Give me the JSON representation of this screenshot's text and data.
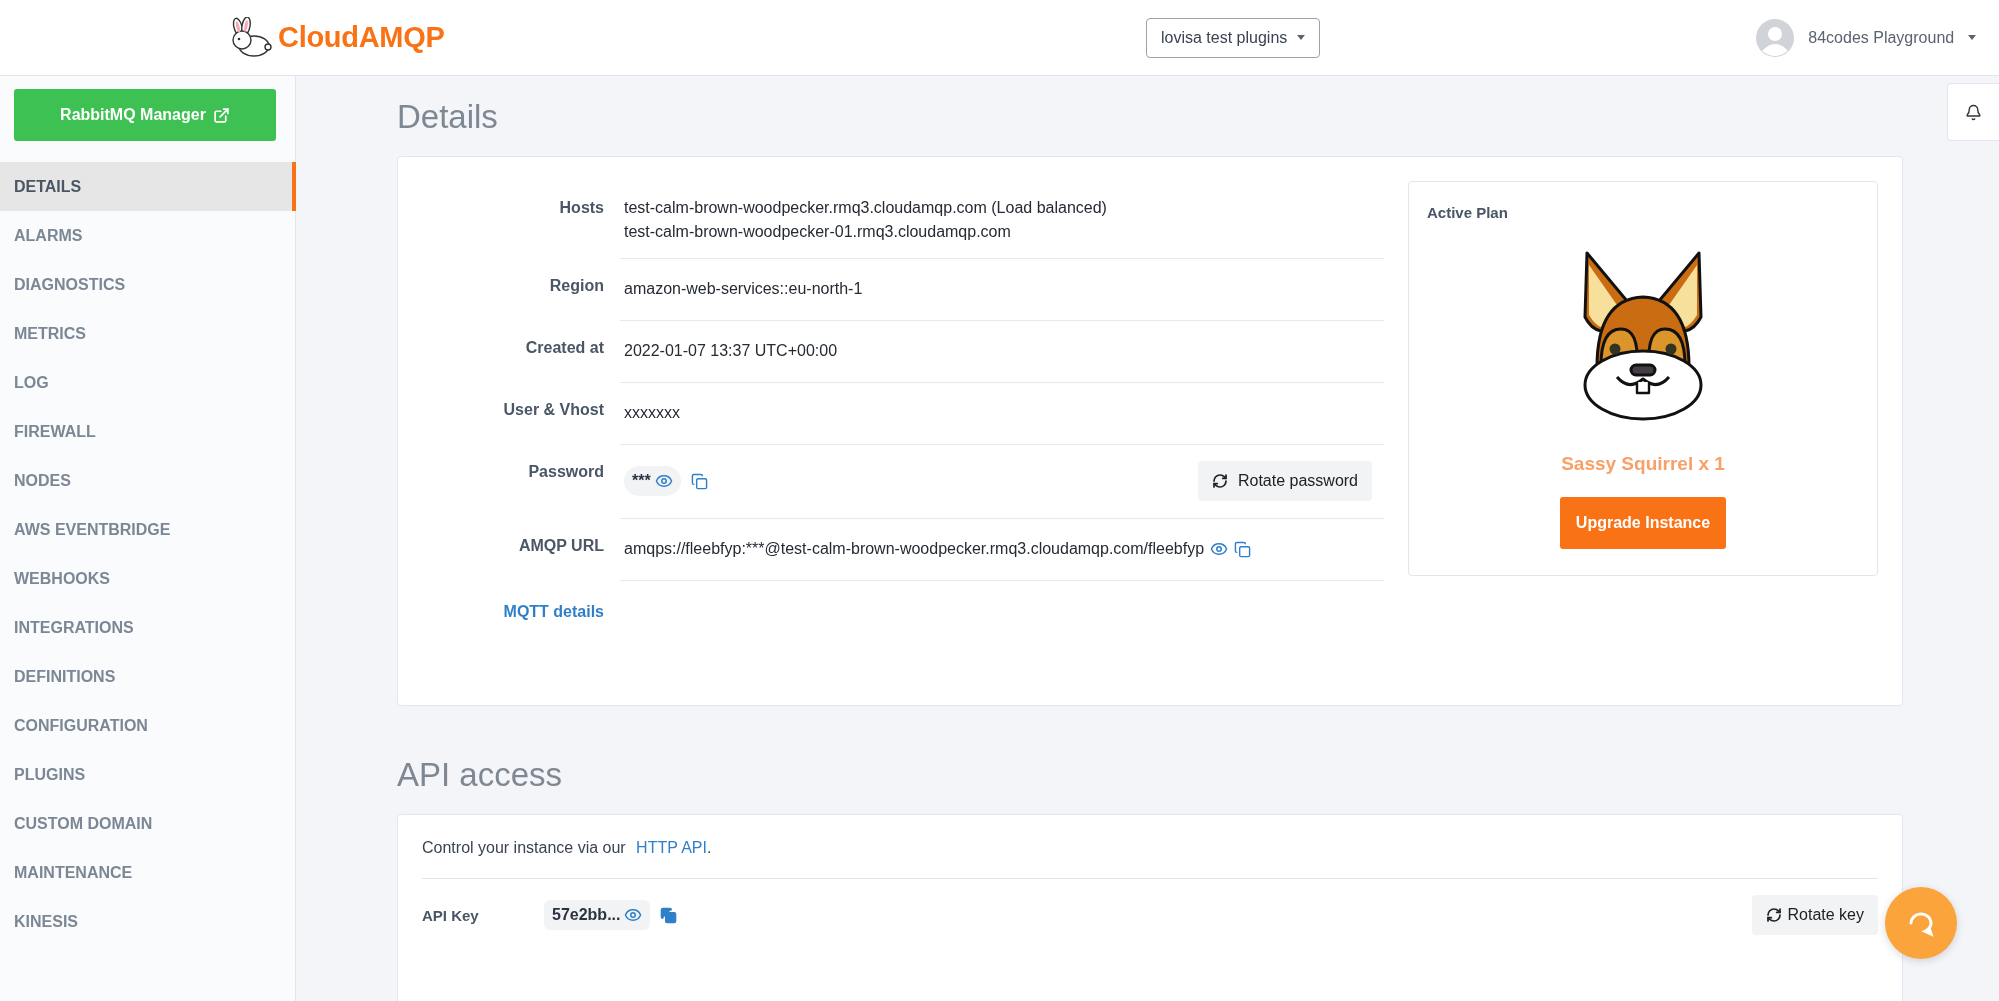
{
  "header": {
    "brand": "CloudAMQP",
    "instance_select": "lovisa test plugins",
    "account": "84codes Playground"
  },
  "sidebar": {
    "manager_button": "RabbitMQ Manager",
    "items": [
      {
        "label": "DETAILS",
        "selected": true
      },
      {
        "label": "ALARMS",
        "selected": false
      },
      {
        "label": "DIAGNOSTICS",
        "selected": false
      },
      {
        "label": "METRICS",
        "selected": false
      },
      {
        "label": "LOG",
        "selected": false
      },
      {
        "label": "FIREWALL",
        "selected": false
      },
      {
        "label": "NODES",
        "selected": false
      },
      {
        "label": "AWS EVENTBRIDGE",
        "selected": false
      },
      {
        "label": "WEBHOOKS",
        "selected": false
      },
      {
        "label": "INTEGRATIONS",
        "selected": false
      },
      {
        "label": "DEFINITIONS",
        "selected": false
      },
      {
        "label": "CONFIGURATION",
        "selected": false
      },
      {
        "label": "PLUGINS",
        "selected": false
      },
      {
        "label": "CUSTOM DOMAIN",
        "selected": false
      },
      {
        "label": "MAINTENANCE",
        "selected": false
      },
      {
        "label": "KINESIS",
        "selected": false
      }
    ]
  },
  "details": {
    "title": "Details",
    "rows": [
      {
        "kind": "lines",
        "label": "Hosts",
        "lines": [
          "test-calm-brown-woodpecker.rmq3.cloudamqp.com (Load balanced)",
          "test-calm-brown-woodpecker-01.rmq3.cloudamqp.com"
        ]
      },
      {
        "kind": "text",
        "label": "Region",
        "value": "amazon-web-services::eu-north-1"
      },
      {
        "kind": "text",
        "label": "Created at",
        "value": "2022-01-07 13:37 UTC+00:00"
      },
      {
        "kind": "text",
        "label": "User & Vhost",
        "value": "xxxxxxx"
      },
      {
        "kind": "secret",
        "label": "Password",
        "value": "***",
        "button": "Rotate password"
      },
      {
        "kind": "url",
        "label": "AMQP URL",
        "value": "amqps://fleebfyp:***@test-calm-brown-woodpecker.rmq3.cloudamqp.com/fleebfyp"
      }
    ],
    "mqtt_link": "MQTT details",
    "plan": {
      "title": "Active Plan",
      "name": "Sassy Squirrel x 1",
      "button": "Upgrade Instance"
    }
  },
  "api_access": {
    "title": "API access",
    "intro": "Control your instance via our",
    "link": "HTTP API",
    "suffix": ".",
    "key_label": "API Key",
    "key_value": "57e2bb...",
    "rotate_button": "Rotate key"
  }
}
